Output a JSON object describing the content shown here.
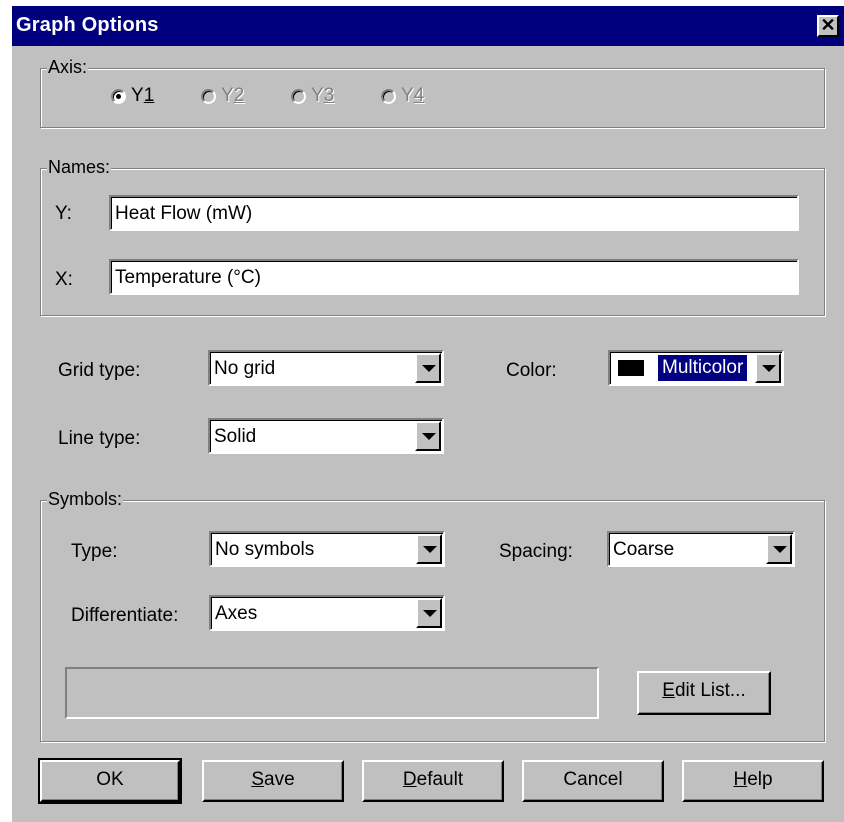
{
  "window": {
    "title": "Graph Options",
    "close_glyph": "✕"
  },
  "axis": {
    "legend": "Axis:",
    "options": [
      {
        "prefix": "Y",
        "mnemonic": "1",
        "checked": true,
        "enabled": true
      },
      {
        "prefix": "Y",
        "mnemonic": "2",
        "checked": false,
        "enabled": false
      },
      {
        "prefix": "Y",
        "mnemonic": "3",
        "checked": false,
        "enabled": false
      },
      {
        "prefix": "Y",
        "mnemonic": "4",
        "checked": false,
        "enabled": false
      }
    ]
  },
  "names": {
    "legend": "Names:",
    "y_label": "Y:",
    "y_value": "Heat Flow (mW)",
    "x_label": "X:",
    "x_value": "Temperature  (°C)"
  },
  "grid": {
    "label": "Grid type:",
    "value": "No grid"
  },
  "color": {
    "label": "Color:",
    "value": "Multicolor",
    "swatch_color": "#000000"
  },
  "line": {
    "label": "Line type:",
    "value": "Solid"
  },
  "symbols": {
    "legend": "Symbols:",
    "type_label": "Type:",
    "type_value": "No symbols",
    "spacing_label": "Spacing:",
    "spacing_value": "Coarse",
    "differentiate_label": "Differentiate:",
    "differentiate_value": "Axes",
    "edit_list_mnemonic": "E",
    "edit_list_rest": "dit List..."
  },
  "buttons": {
    "ok": "OK",
    "save_mnemonic": "S",
    "save_rest": "ave",
    "default_mnemonic": "D",
    "default_rest": "efault",
    "cancel": "Cancel",
    "help_mnemonic": "H",
    "help_rest": "elp"
  },
  "colors": {
    "titlebar": "#00007f",
    "face": "#c0c0c0",
    "selection": "#000080"
  }
}
